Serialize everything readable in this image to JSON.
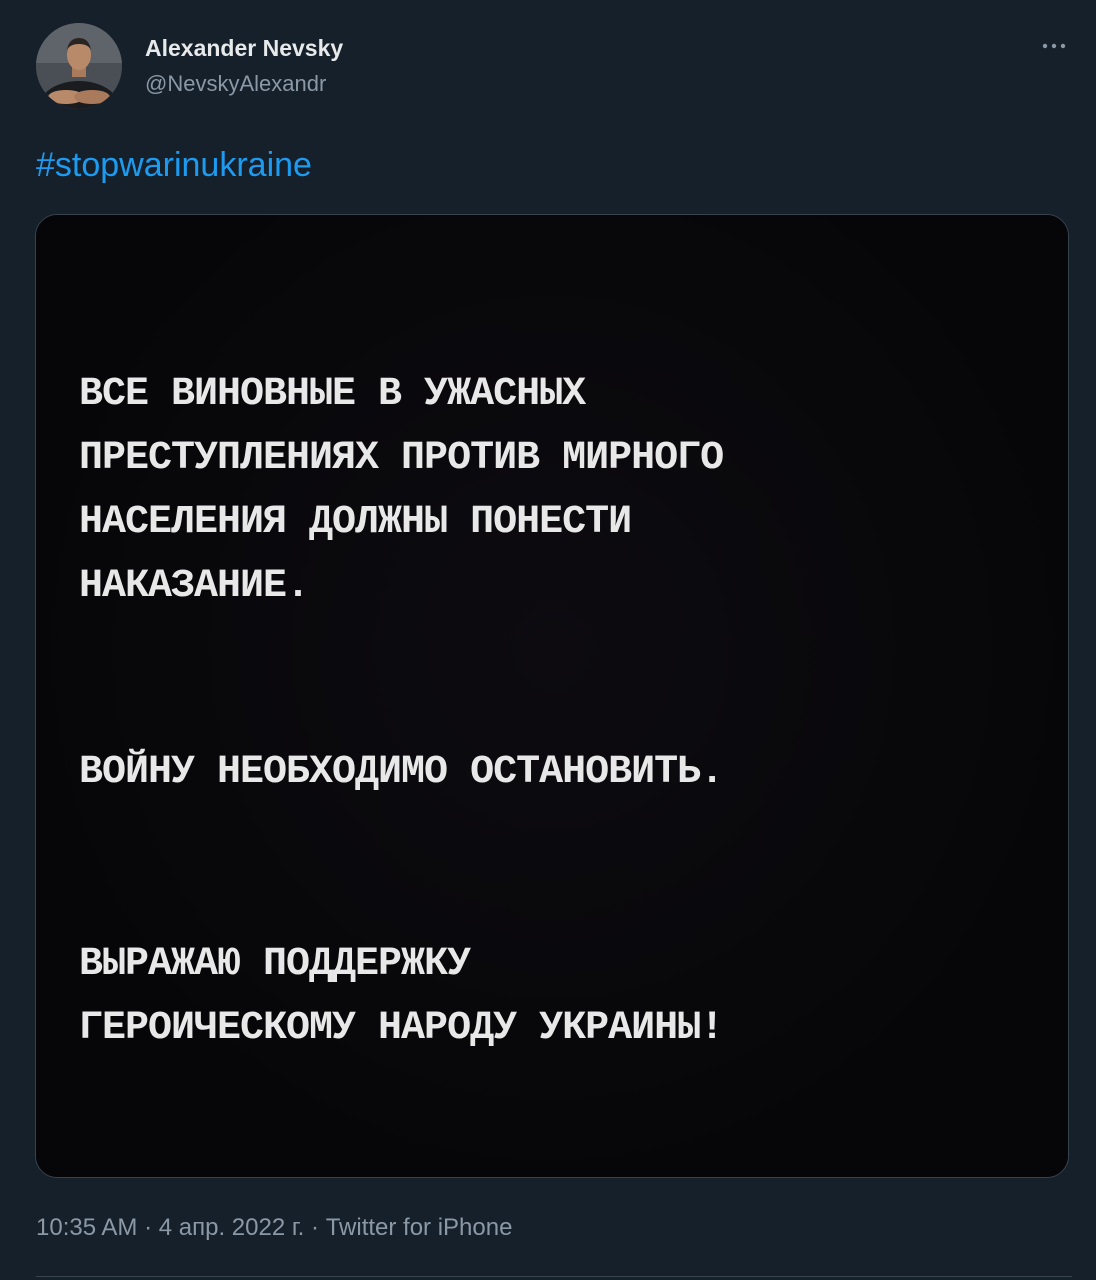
{
  "tweet": {
    "author": {
      "display_name": "Alexander Nevsky",
      "handle": "@NevskyAlexandr"
    },
    "more_icon": "more-horizontal-icon",
    "hashtag": "#stopwarinukraine",
    "image_text": {
      "paragraph_1": "ВСЕ ВИНОВНЫЕ В УЖАСНЫХ\nПРЕСТУПЛЕНИЯХ ПРОТИВ МИРНОГО\nНАСЕЛЕНИЯ ДОЛЖНЫ ПОНЕСТИ\nНАКАЗАНИЕ.",
      "paragraph_2": "ВОЙНУ НЕОБХОДИМО ОСТАНОВИТЬ.",
      "paragraph_3": "ВЫРАЖАЮ ПОДДЕРЖКУ\nГЕРОИЧЕСКОМУ НАРОДУ УКРАИНЫ!"
    },
    "meta": {
      "time": "10:35 AM",
      "separator": "·",
      "date": "4 апр. 2022 г.",
      "source": "Twitter for iPhone"
    }
  },
  "colors": {
    "background": "#15202b",
    "link": "#1d9bf0",
    "primary_text": "#e7e9ea",
    "secondary_text": "#8b98a5",
    "border": "#38444d"
  }
}
